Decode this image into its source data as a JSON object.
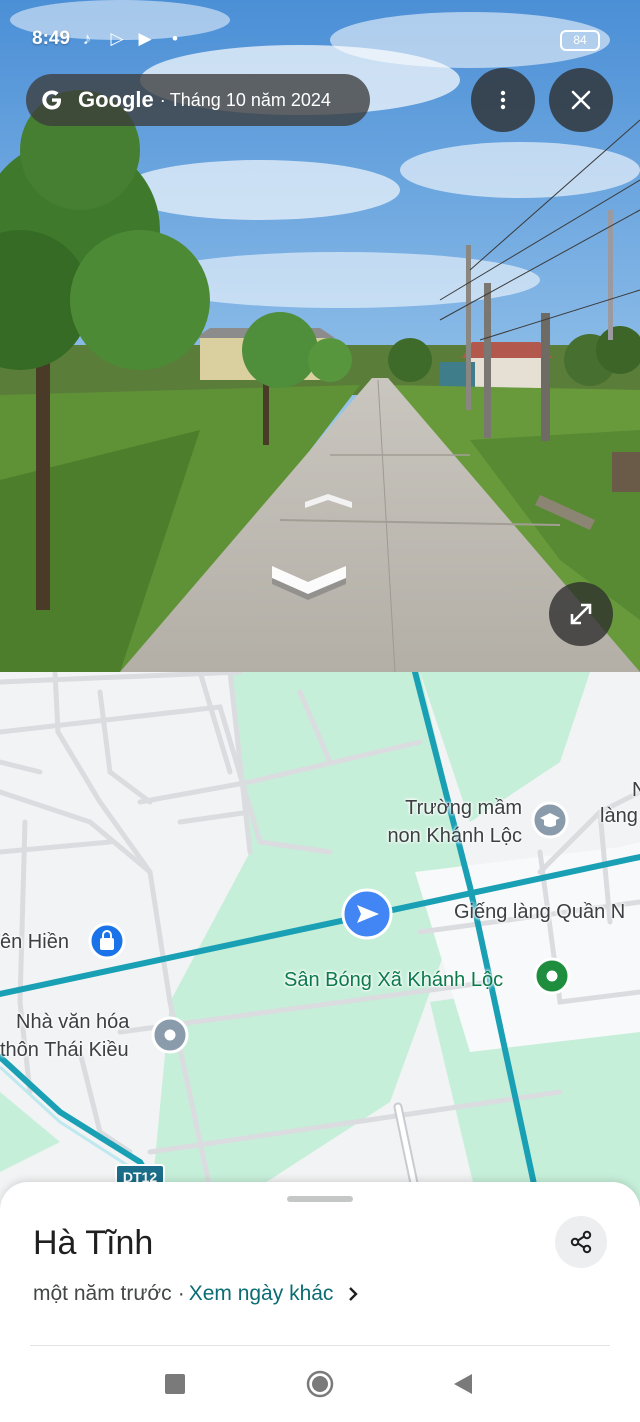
{
  "status_bar": {
    "time": "8:49",
    "battery": "84"
  },
  "street_view": {
    "brand": "Google",
    "separator": "·",
    "capture_date": "Tháng 10 năm 2024"
  },
  "map": {
    "labels": {
      "school": "Trường mầm\nnon Khánh Lộc",
      "village_right": "làng",
      "village_right_n": "N",
      "well": "Giếng làng Quần N",
      "field": "Sân Bóng Xã Khánh Lộc",
      "shop": "ên Hiền",
      "cultural_house_1": "Nhà văn hóa",
      "cultural_house_2": "thôn Thái Kiều",
      "road_badge": "DT12"
    }
  },
  "sheet": {
    "title": "Hà Tĩnh",
    "relative_date": "một năm trước",
    "separator": "·",
    "other_dates_link": "Xem ngày khác"
  },
  "colors": {
    "sky": "#6aa3dd",
    "road_cyan": "#1aa0b4",
    "green_area": "#c6efd9",
    "map_bg": "#f1f3f4",
    "link": "#0b6c73",
    "location_arrow": "#4285f4"
  },
  "icons": {
    "more": "three-dot-vertical",
    "close": "x",
    "expand": "diagonal-arrows",
    "share": "share-nodes",
    "school_pin": "graduation-cap",
    "shop_pin": "shopping-bag",
    "park_pin": "green-dot",
    "place_pin": "gray-dot"
  }
}
